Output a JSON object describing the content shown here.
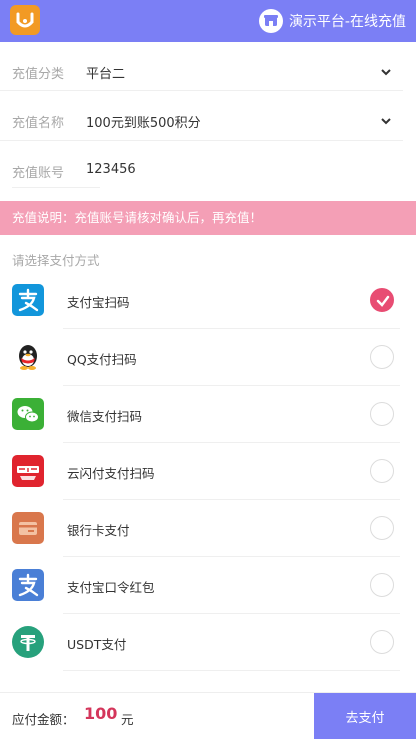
{
  "header": {
    "logo_icon": "smile-bag-icon",
    "brand_icon": "store-icon",
    "brand_text": "演示平台-在线充值"
  },
  "form": {
    "category": {
      "label": "充值分类",
      "value": "平台二"
    },
    "name": {
      "label": "充值名称",
      "value": "100元到账500积分"
    },
    "account": {
      "label": "充值账号",
      "value": "123456"
    }
  },
  "notice": "充值说明：充值账号请核对确认后，再充值！",
  "payment": {
    "title": "请选择支付方式",
    "methods": [
      {
        "label": "支付宝扫码",
        "icon": "alipay-icon",
        "checked": true
      },
      {
        "label": "QQ支付扫码",
        "icon": "qq-penguin-icon",
        "checked": false
      },
      {
        "label": "微信支付扫码",
        "icon": "wechat-icon",
        "checked": false
      },
      {
        "label": "云闪付支付扫码",
        "icon": "unionpay-quickpass-icon",
        "checked": false
      },
      {
        "label": "银行卡支付",
        "icon": "bank-card-icon",
        "checked": false
      },
      {
        "label": "支付宝口令红包",
        "icon": "alipay-icon",
        "checked": false
      },
      {
        "label": "USDT支付",
        "icon": "tether-icon",
        "checked": false
      }
    ]
  },
  "footer": {
    "amount_label": "应付金额：",
    "amount": "100",
    "unit": "元",
    "pay_button": "去支付"
  },
  "colors": {
    "accent": "#7b7ff5",
    "notice": "#f49fb6",
    "selected": "#e84d73",
    "amount": "#d4365b"
  }
}
